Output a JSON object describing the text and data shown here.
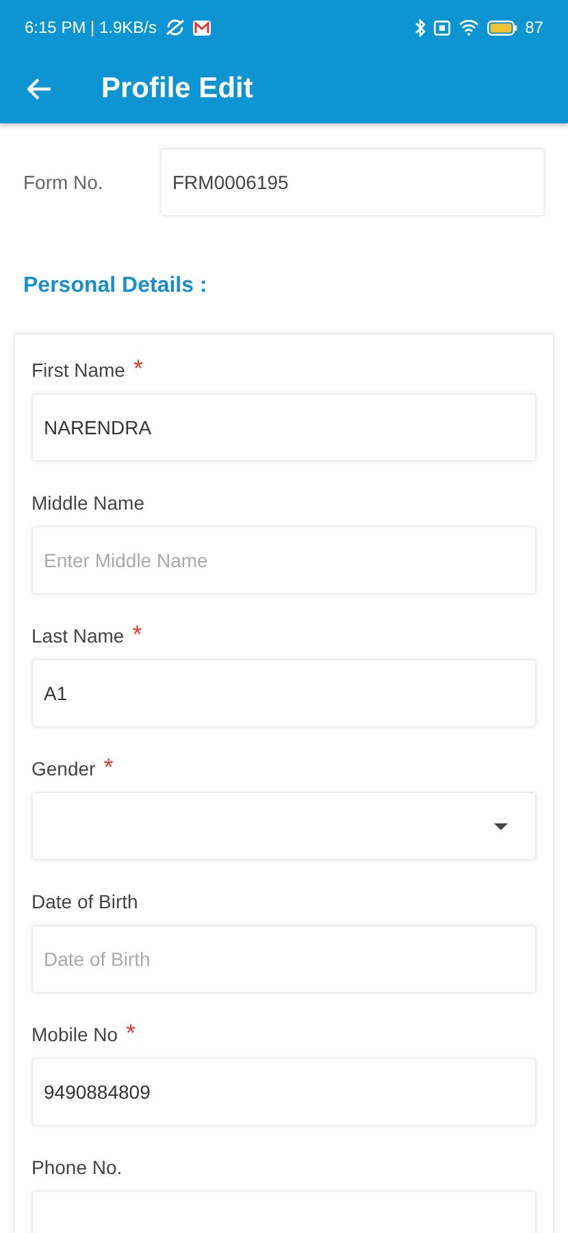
{
  "status_bar": {
    "time": "6:15 PM | 1.9KB/s",
    "battery": "87"
  },
  "header": {
    "title": "Profile Edit"
  },
  "form_no": {
    "label": "Form No.",
    "value": "FRM0006195"
  },
  "section_title": "Personal Details :",
  "required_mark": "*",
  "fields": [
    {
      "kind": "text",
      "label": "First Name",
      "required": true,
      "value": "NARENDRA"
    },
    {
      "kind": "text",
      "label": "Middle Name",
      "required": false,
      "placeholder": "Enter Middle Name"
    },
    {
      "kind": "text",
      "label": "Last Name",
      "required": true,
      "value": "A1"
    },
    {
      "kind": "dropdown",
      "label": "Gender",
      "required": true
    },
    {
      "kind": "text",
      "label": "Date of Birth",
      "required": false,
      "placeholder": "Date of Birth"
    },
    {
      "kind": "text",
      "label": "Mobile No",
      "required": true,
      "value": "9490884809"
    },
    {
      "kind": "text",
      "label": "Phone No.",
      "required": false
    }
  ]
}
